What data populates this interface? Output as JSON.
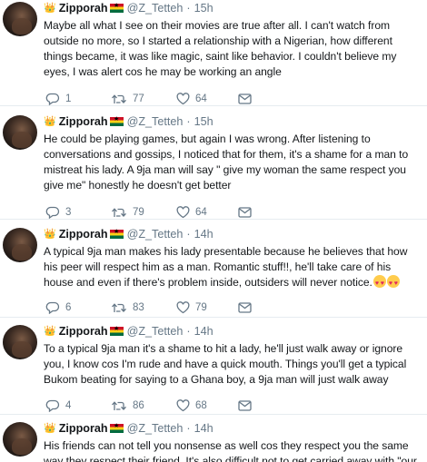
{
  "tweets": [
    {
      "name": "Zipporah",
      "handle": "@Z_Tetteh",
      "time": "15h",
      "text": "Maybe all what I see on their movies are true after all. I can't watch from outside no more, so I started a relationship with a Nigerian, how different things became, it was like magic, saint like behavior. I couldn't believe my eyes, I was alert cos he may be working an angle",
      "replies": "1",
      "retweets": "77",
      "likes": "64"
    },
    {
      "name": "Zipporah",
      "handle": "@Z_Tetteh",
      "time": "15h",
      "text": "He could be playing games, but again I was wrong. After listening to conversations and gossips, I noticed that for them, it's a shame for a man to mistreat his lady. A 9ja man will say \" give my woman the same respect you give me\" honestly he doesn't get better",
      "replies": "3",
      "retweets": "79",
      "likes": "64"
    },
    {
      "name": "Zipporah",
      "handle": "@Z_Tetteh",
      "time": "14h",
      "text": "A typical 9ja man makes his lady presentable because he believes that how his peer will respect him as a man. Romantic stuff!!, he'll take care of his house and even if there's problem inside, outsiders will never notice.",
      "emoji_count": 2,
      "replies": "6",
      "retweets": "83",
      "likes": "79"
    },
    {
      "name": "Zipporah",
      "handle": "@Z_Tetteh",
      "time": "14h",
      "text": "To a typical 9ja man it's a shame to hit a lady, he'll just walk away or ignore you,  I know cos I'm rude and have a quick mouth. Things you'll get a typical Bukom beating for saying to a Ghana boy, a 9ja man will just walk away",
      "replies": "4",
      "retweets": "86",
      "likes": "68"
    },
    {
      "name": "Zipporah",
      "handle": "@Z_Tetteh",
      "time": "14h",
      "text": "His friends can not tell you nonsense as well cos they respect you the same way they respect their friend. It's also difficult not to get carried away with \"our wife\"",
      "replies": "",
      "retweets": "",
      "likes": ""
    }
  ],
  "icons": {
    "crown": "crown-emoji",
    "flag": "ghana-flag-emoji",
    "reply": "reply-icon",
    "retweet": "retweet-icon",
    "like": "heart-icon",
    "dm": "envelope-icon",
    "emoji": "heart-eyes-emoji"
  },
  "colors": {
    "text": "#14171a",
    "muted": "#657786",
    "divider": "#e6ecf0"
  }
}
